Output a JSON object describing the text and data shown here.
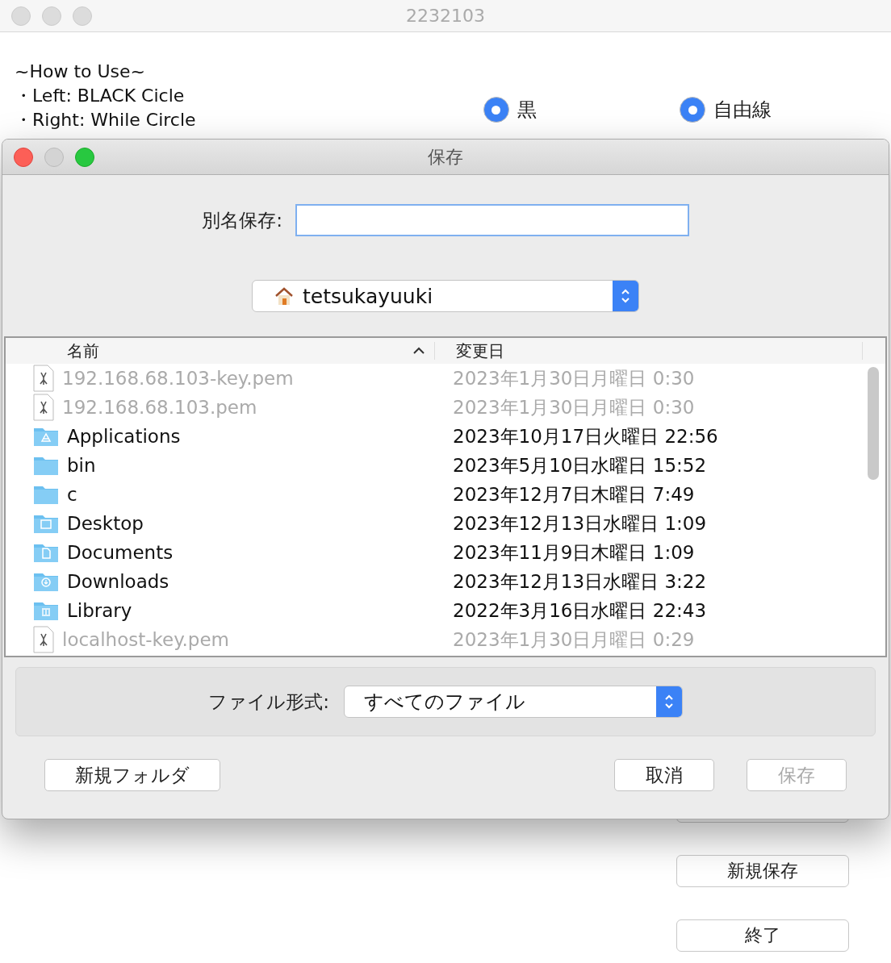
{
  "window": {
    "title": "2232103"
  },
  "instructions": [
    "~How to Use~",
    "・Left: BLACK Cicle",
    "・Right: While Circle"
  ],
  "radios": [
    {
      "label": "黒",
      "selected": true
    },
    {
      "label": "自由線",
      "selected": true
    }
  ],
  "side_buttons": [
    {
      "label": "新規保存"
    },
    {
      "label": "終了"
    }
  ],
  "dialog": {
    "title": "保存",
    "save_as_label": "別名保存:",
    "location": "tetsukayuuki",
    "columns": [
      {
        "label": "名前",
        "sorted": true
      },
      {
        "label": "変更日",
        "sorted": false
      }
    ],
    "files": [
      {
        "name": "192.168.68.103-key.pem",
        "date": "2023年1月30日月曜日 0:30",
        "kind": "file",
        "disabled": true
      },
      {
        "name": "192.168.68.103.pem",
        "date": "2023年1月30日月曜日 0:30",
        "kind": "file",
        "disabled": true
      },
      {
        "name": "Applications",
        "date": "2023年10月17日火曜日 22:56",
        "kind": "applications",
        "disabled": false
      },
      {
        "name": "bin",
        "date": "2023年5月10日水曜日 15:52",
        "kind": "folder",
        "disabled": false
      },
      {
        "name": "c",
        "date": "2023年12月7日木曜日 7:49",
        "kind": "folder",
        "disabled": false
      },
      {
        "name": "Desktop",
        "date": "2023年12月13日水曜日 1:09",
        "kind": "desktop",
        "disabled": false
      },
      {
        "name": "Documents",
        "date": "2023年11月9日木曜日 1:09",
        "kind": "documents",
        "disabled": false
      },
      {
        "name": "Downloads",
        "date": "2023年12月13日水曜日 3:22",
        "kind": "downloads",
        "disabled": false
      },
      {
        "name": "Library",
        "date": "2022年3月16日水曜日 22:43",
        "kind": "library",
        "disabled": false
      },
      {
        "name": "localhost-key.pem",
        "date": "2023年1月30日月曜日 0:29",
        "kind": "file",
        "disabled": true
      }
    ],
    "format_label": "ファイル形式:",
    "format_value": "すべてのファイル",
    "buttons": [
      {
        "label": "新規フォルダ",
        "kind": "left",
        "disabled": false
      },
      {
        "label": "取消",
        "kind": "right",
        "disabled": false
      },
      {
        "label": "保存",
        "kind": "right",
        "disabled": true
      }
    ]
  }
}
